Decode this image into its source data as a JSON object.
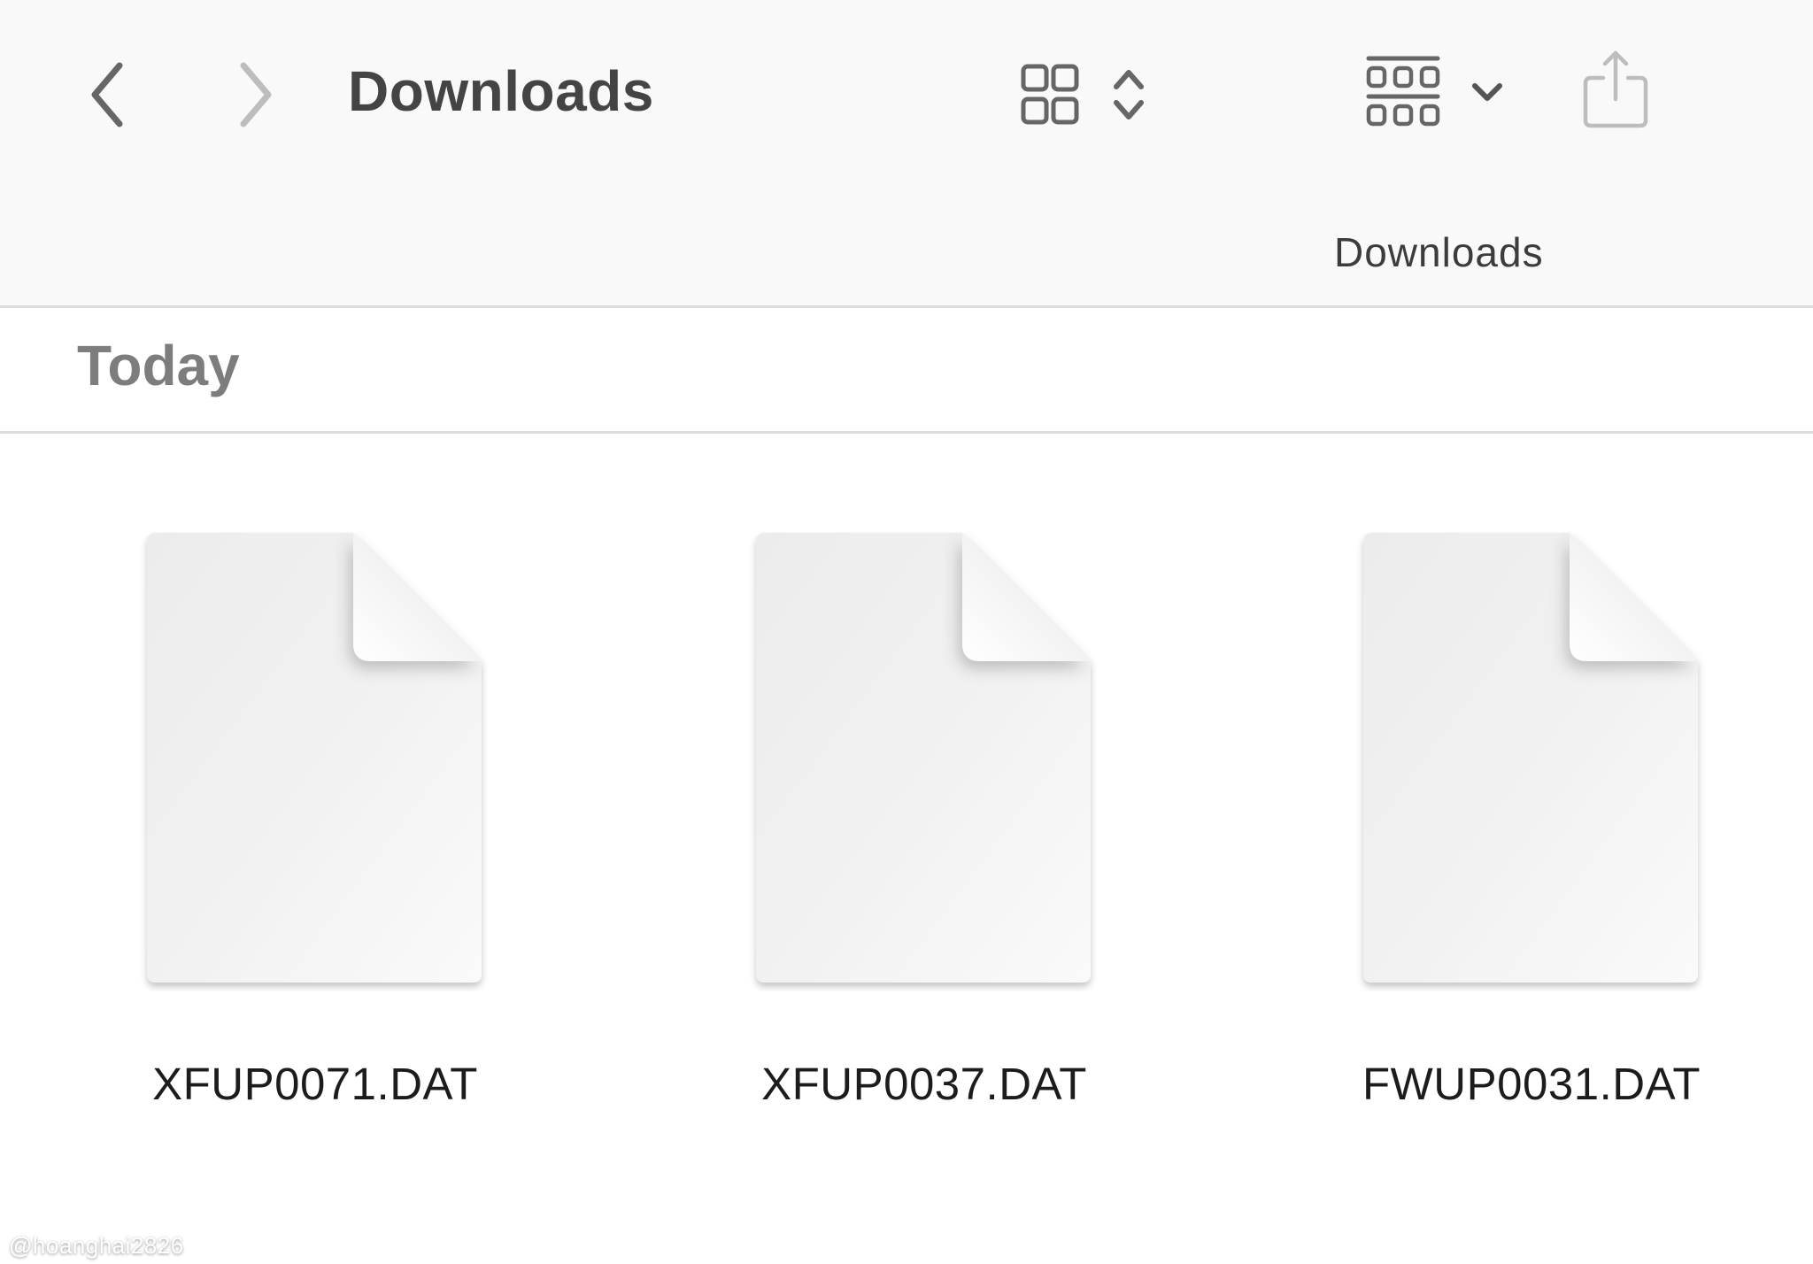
{
  "toolbar": {
    "title": "Downloads",
    "location_label": "Downloads",
    "back_icon": "chevron-left-icon",
    "forward_icon": "chevron-right-icon",
    "view_icon": "icon-grid-view-icon",
    "view_sort_icon": "chevron-up-down-icon",
    "group_icon": "group-by-icon",
    "group_menu_icon": "chevron-down-icon",
    "share_icon": "share-icon",
    "forward_enabled": false,
    "share_enabled": false
  },
  "section": {
    "title": "Today"
  },
  "files": [
    {
      "name": "XFUP0071.DAT",
      "icon": "generic-document-icon"
    },
    {
      "name": "XFUP0037.DAT",
      "icon": "generic-document-icon"
    },
    {
      "name": "FWUP0031.DAT",
      "icon": "generic-document-icon"
    }
  ],
  "watermark": "@hoanghai2826",
  "colors": {
    "toolbar_bg": "#f9f9f9",
    "icon_active": "#666666",
    "icon_disabled": "#bdbdbd",
    "title_text": "#444444",
    "section_text": "#7d7d7d"
  }
}
